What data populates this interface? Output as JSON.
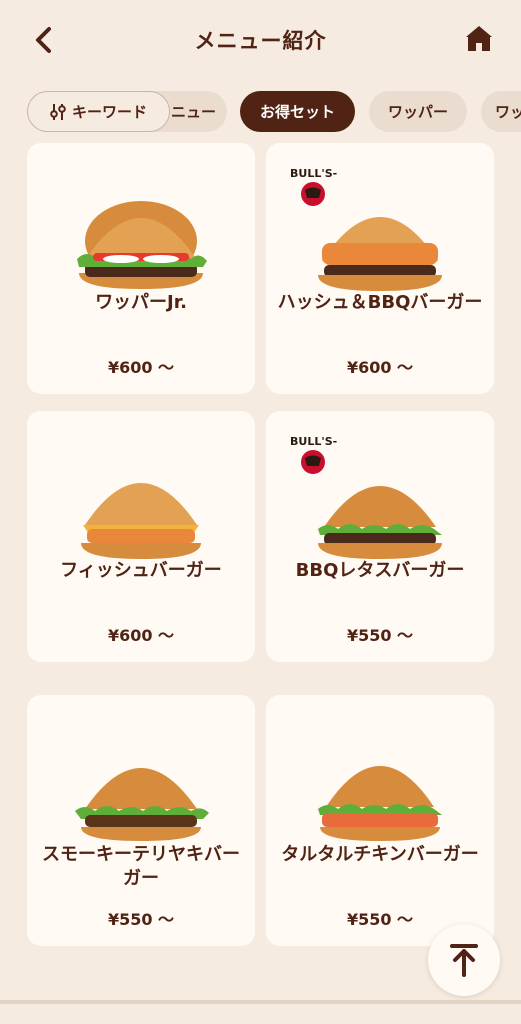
{
  "header": {
    "title": "メニュー紹介",
    "back_icon": "chevron-left-icon",
    "home_icon": "home-icon"
  },
  "filter": {
    "label": "キーワード",
    "icon": "sliders-icon"
  },
  "tabs": [
    {
      "label": "ニュー"
    },
    {
      "label": "お得セット",
      "active": true
    },
    {
      "label": "ワッパー"
    },
    {
      "label": "ワッ"
    }
  ],
  "products": [
    {
      "name": "ワッパーJr.",
      "price": "¥600 ～",
      "burger": "whopper"
    },
    {
      "name": "ハッシュ＆BBQバーガー",
      "price": "¥600 ～",
      "burger": "hash",
      "badge": "BULL'S-EYE"
    },
    {
      "name": "フィッシュバーガー",
      "price": "¥600 ～",
      "burger": "fish"
    },
    {
      "name": "BBQレタスバーガー",
      "price": "¥550 ～",
      "burger": "bbq",
      "badge": "BULL'S-EYE"
    },
    {
      "name": "スモーキーテリヤキバーガー",
      "price": "¥550 ～",
      "burger": "teriyaki"
    },
    {
      "name": "タルタルチキンバーガー",
      "price": "¥550 ～",
      "burger": "tartar"
    }
  ],
  "colors": {
    "brand": "#502314",
    "background": "#f5ebe0",
    "card": "#fffaf3",
    "tab": "#eaddd0"
  },
  "scroll_top_icon": "arrow-up-icon"
}
